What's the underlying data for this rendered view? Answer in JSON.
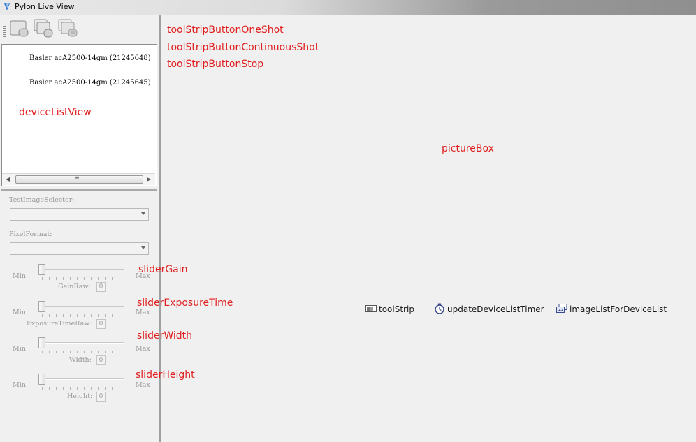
{
  "window": {
    "title": "Pylon Live View"
  },
  "toolstrip": {
    "buttons": [
      {
        "icon": "one-shot-icon"
      },
      {
        "icon": "continuous-shot-icon"
      },
      {
        "icon": "stop-icon"
      }
    ]
  },
  "device_list": {
    "items": [
      {
        "label": "Basler acA2500-14gm (21245648)"
      },
      {
        "label": "Basler acA2500-14gm (21245645)"
      }
    ]
  },
  "settings": {
    "test_image_selector_label": "TestImageSelector:",
    "pixel_format_label": "PixelFormat:",
    "sliders": [
      {
        "min": "Min",
        "max": "Max",
        "name": "GainRaw:",
        "value": "0"
      },
      {
        "min": "Min",
        "max": "Max",
        "name": "ExposureTimeRaw:",
        "value": "0"
      },
      {
        "min": "Min",
        "max": "Max",
        "name": "Width:",
        "value": "0"
      },
      {
        "min": "Min",
        "max": "Max",
        "name": "Height:",
        "value": "0"
      }
    ]
  },
  "annotations": {
    "one_shot": "toolStripButtonOneShot",
    "continuous_shot": "toolStripButtonContinuousShot",
    "stop": "toolStripButtonStop",
    "device_list_view": "deviceListView",
    "picture_box": "pictureBox",
    "slider_gain": "sliderGain",
    "slider_exposure": "sliderExposureTime",
    "slider_width": "sliderWidth",
    "slider_height": "sliderHeight"
  },
  "components": {
    "tool_strip": "toolStrip",
    "timer": "updateDeviceListTimer",
    "image_list": "imageListForDeviceList"
  },
  "colors": {
    "annotation": "#e02020",
    "background": "#f0f0f0",
    "separator": "#a0a0a0"
  }
}
